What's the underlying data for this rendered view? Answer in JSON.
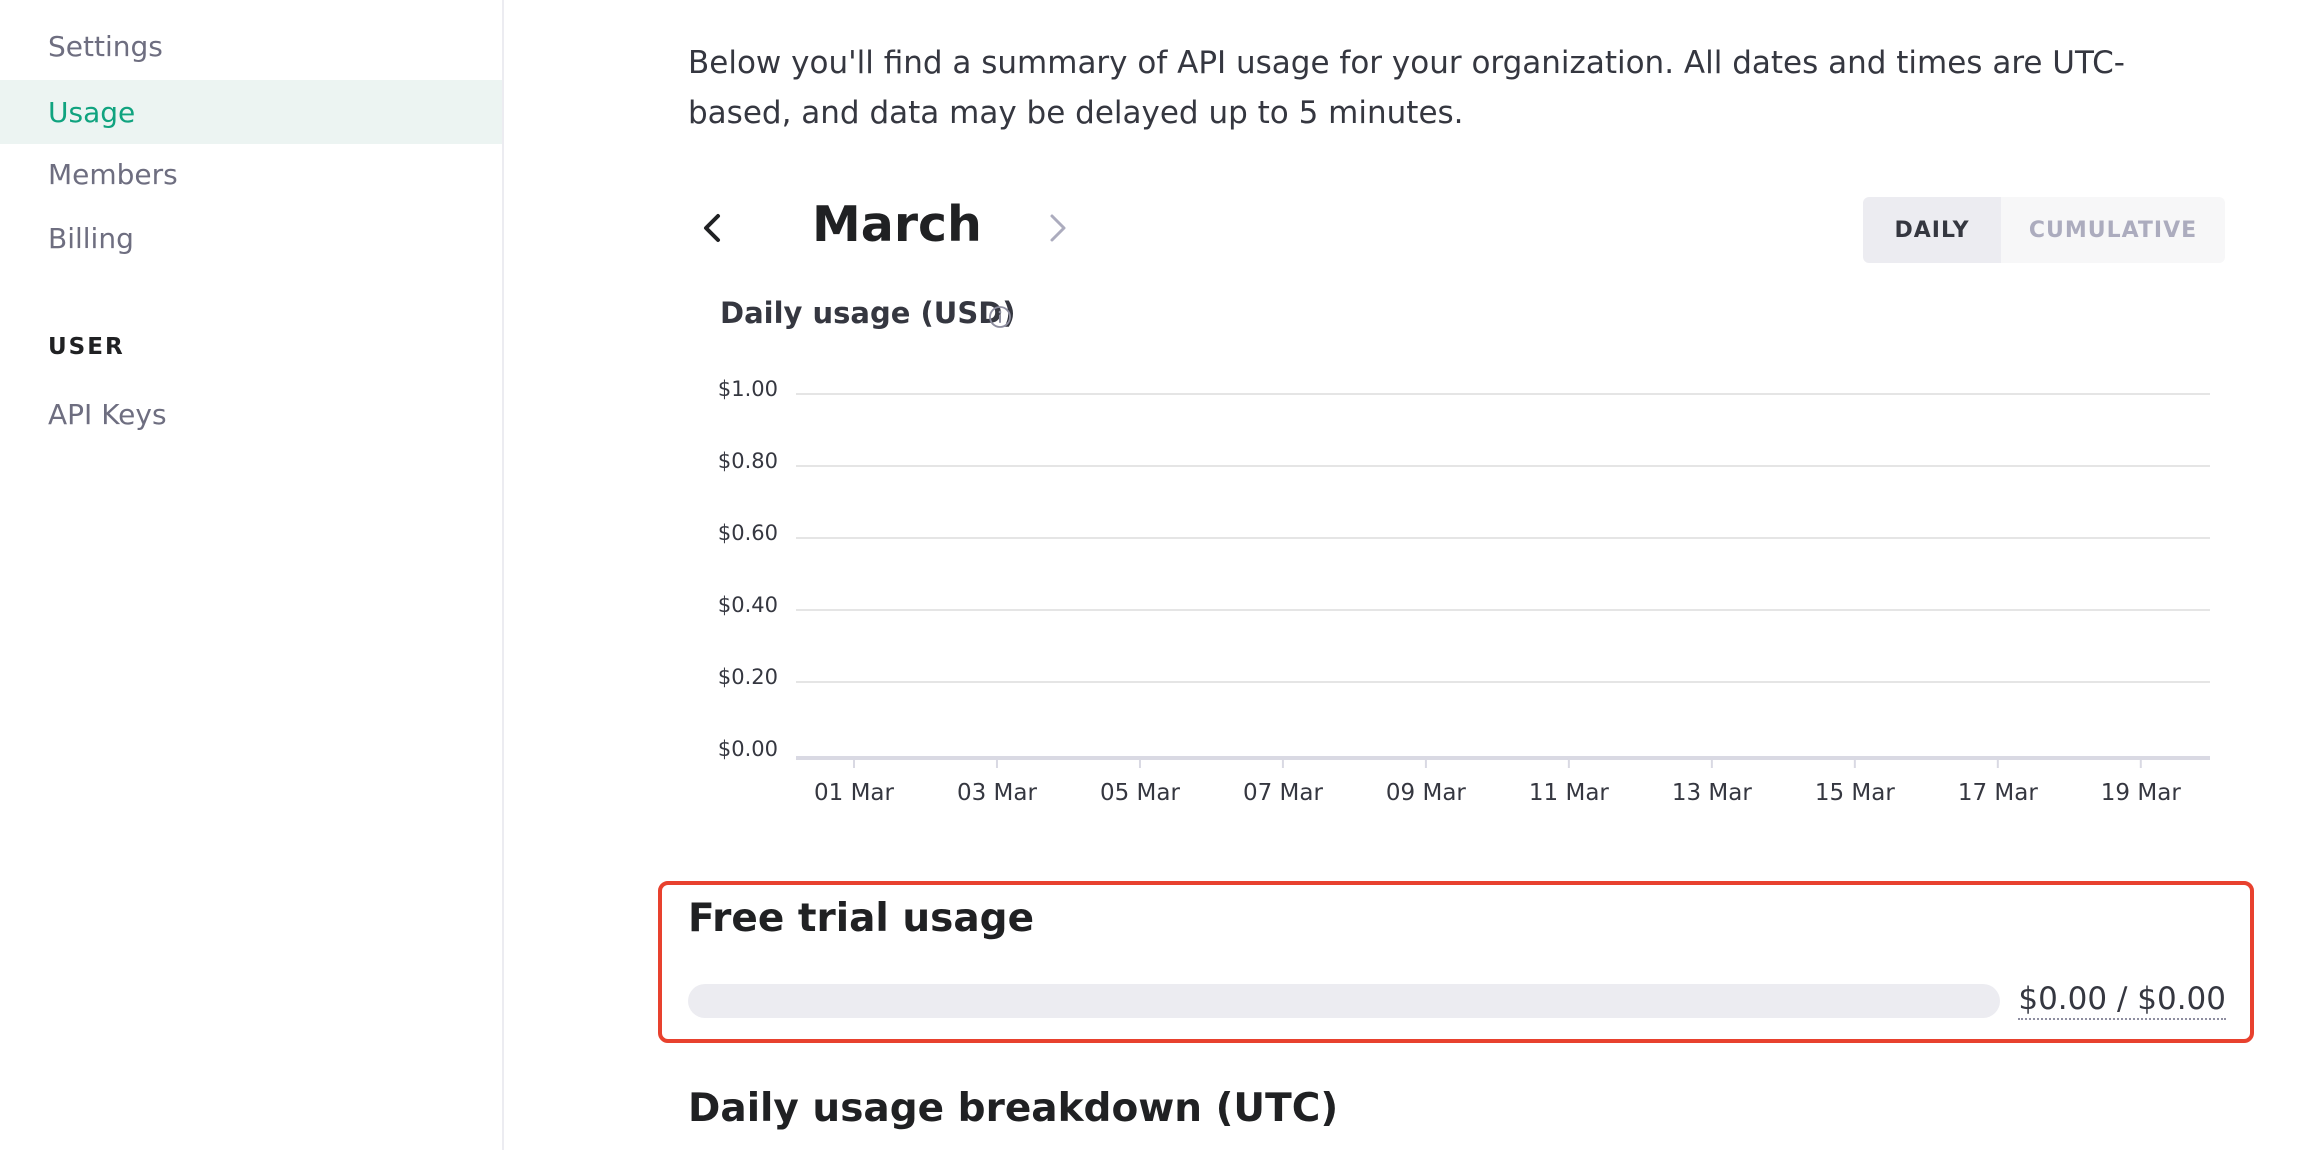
{
  "sidebar": {
    "items": [
      {
        "label": "Settings"
      },
      {
        "label": "Usage",
        "active": true
      },
      {
        "label": "Members"
      },
      {
        "label": "Billing"
      }
    ],
    "user_section_label": "USER",
    "user_items": [
      {
        "label": "API Keys"
      }
    ]
  },
  "main": {
    "intro": "Below you'll find a summary of API usage for your organization. All dates and times are UTC-based, and data may be delayed up to 5 minutes.",
    "month": "March",
    "view_toggle": {
      "daily_label": "DAILY",
      "cumulative_label": "CUMULATIVE",
      "selected": "DAILY"
    },
    "chart_title": "Daily usage (USD)",
    "free_trial": {
      "title": "Free trial usage",
      "amount_text": "$0.00 / $0.00",
      "used_fraction": 0
    },
    "breakdown_title": "Daily usage breakdown (UTC)"
  },
  "colors": {
    "accent": "#10a37f",
    "active_bg": "#ecf4f2",
    "highlight_border": "#e8412e"
  },
  "chart_data": {
    "type": "bar",
    "title": "Daily usage (USD)",
    "xlabel": "",
    "ylabel": "",
    "ylim": [
      0,
      1
    ],
    "y_ticks": [
      "$1.00",
      "$0.80",
      "$0.60",
      "$0.40",
      "$0.20",
      "$0.00"
    ],
    "y_tick_values": [
      1.0,
      0.8,
      0.6,
      0.4,
      0.2,
      0.0
    ],
    "categories": [
      "01 Mar",
      "03 Mar",
      "05 Mar",
      "07 Mar",
      "09 Mar",
      "11 Mar",
      "13 Mar",
      "15 Mar",
      "17 Mar",
      "19 Mar"
    ],
    "values": [
      0,
      0,
      0,
      0,
      0,
      0,
      0,
      0,
      0,
      0
    ],
    "grid": true
  }
}
